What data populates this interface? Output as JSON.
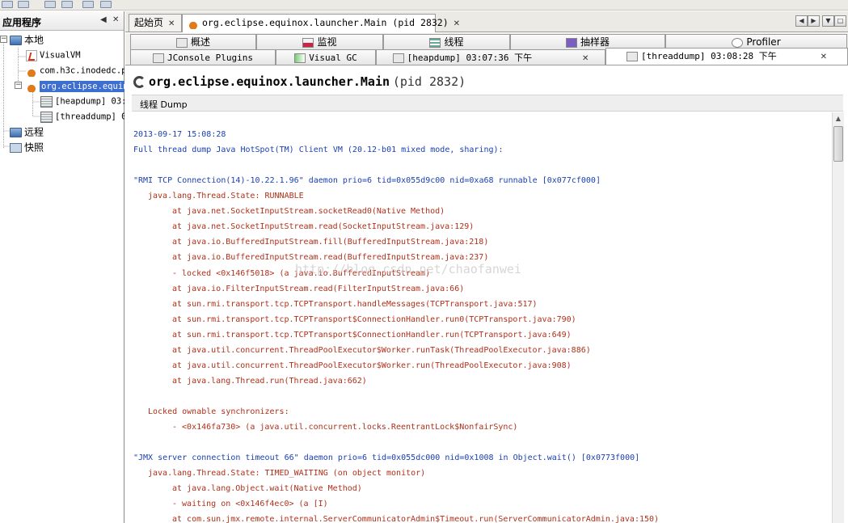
{
  "left_panel": {
    "title": "应用程序",
    "pin_label": "◀",
    "close_label": "✕",
    "nodes": {
      "local": "本地",
      "visualvm": "VisualVM",
      "h3c": "com.h3c.inodedc.p",
      "eclipse": "org.eclipse.equin",
      "heapdump": "[heapdump] 03:",
      "threaddump": "[threaddump] 0",
      "remote": "远程",
      "snapshot": "快照"
    }
  },
  "doc_tabs": {
    "start": "起始页",
    "start_close": "✕",
    "process": "org.eclipse.equinox.launcher.Main (pid 2832)",
    "process_close": "✕"
  },
  "sub_tabs_row1": [
    "概述",
    "监视",
    "线程",
    "抽样器",
    "Profiler"
  ],
  "sub_tabs_row2": {
    "jconsole": "JConsole Plugins",
    "visualgc": "Visual GC",
    "heapdump": "[heapdump] 03:07:36 下午",
    "heapdump_close": "✕",
    "threaddump": "[threaddump] 03:08:28 下午",
    "threaddump_close": "✕"
  },
  "content": {
    "main_class": "org.eclipse.equinox.launcher.Main",
    "pid": "(pid 2832)",
    "section": "线程 Dump"
  },
  "watermark": "http://blog.csdn.net/chaofanwei",
  "dump_lines": [
    {
      "text": "2013-09-17 15:08:28",
      "color": "blue",
      "indent": 0
    },
    {
      "text": "Full thread dump Java HotSpot(TM) Client VM (20.12-b01 mixed mode, sharing):",
      "color": "blue",
      "indent": 0
    },
    {
      "text": "",
      "color": "blue",
      "indent": 0
    },
    {
      "text": "\"RMI TCP Connection(14)-10.22.1.96\" daemon prio=6 tid=0x055d9c00 nid=0xa68 runnable [0x077cf000]",
      "color": "blue",
      "indent": 0
    },
    {
      "text": "java.lang.Thread.State: RUNNABLE",
      "color": "red",
      "indent": 1
    },
    {
      "text": "at java.net.SocketInputStream.socketRead0(Native Method)",
      "color": "red",
      "indent": 2
    },
    {
      "text": "at java.net.SocketInputStream.read(SocketInputStream.java:129)",
      "color": "red",
      "indent": 2
    },
    {
      "text": "at java.io.BufferedInputStream.fill(BufferedInputStream.java:218)",
      "color": "red",
      "indent": 2
    },
    {
      "text": "at java.io.BufferedInputStream.read(BufferedInputStream.java:237)",
      "color": "red",
      "indent": 2
    },
    {
      "text": "- locked <0x146f5018> (a java.io.BufferedInputStream)",
      "color": "red",
      "indent": 2
    },
    {
      "text": "at java.io.FilterInputStream.read(FilterInputStream.java:66)",
      "color": "red",
      "indent": 2
    },
    {
      "text": "at sun.rmi.transport.tcp.TCPTransport.handleMessages(TCPTransport.java:517)",
      "color": "red",
      "indent": 2
    },
    {
      "text": "at sun.rmi.transport.tcp.TCPTransport$ConnectionHandler.run0(TCPTransport.java:790)",
      "color": "red",
      "indent": 2
    },
    {
      "text": "at sun.rmi.transport.tcp.TCPTransport$ConnectionHandler.run(TCPTransport.java:649)",
      "color": "red",
      "indent": 2
    },
    {
      "text": "at java.util.concurrent.ThreadPoolExecutor$Worker.runTask(ThreadPoolExecutor.java:886)",
      "color": "red",
      "indent": 2
    },
    {
      "text": "at java.util.concurrent.ThreadPoolExecutor$Worker.run(ThreadPoolExecutor.java:908)",
      "color": "red",
      "indent": 2
    },
    {
      "text": "at java.lang.Thread.run(Thread.java:662)",
      "color": "red",
      "indent": 2
    },
    {
      "text": "",
      "color": "red",
      "indent": 0
    },
    {
      "text": "Locked ownable synchronizers:",
      "color": "red",
      "indent": 1
    },
    {
      "text": "- <0x146fa730> (a java.util.concurrent.locks.ReentrantLock$NonfairSync)",
      "color": "red",
      "indent": 2
    },
    {
      "text": "",
      "color": "red",
      "indent": 0
    },
    {
      "text": "\"JMX server connection timeout 66\" daemon prio=6 tid=0x055dc000 nid=0x1008 in Object.wait() [0x0773f000]",
      "color": "blue",
      "indent": 0
    },
    {
      "text": "java.lang.Thread.State: TIMED_WAITING (on object monitor)",
      "color": "red",
      "indent": 1
    },
    {
      "text": "at java.lang.Object.wait(Native Method)",
      "color": "red",
      "indent": 2
    },
    {
      "text": "- waiting on <0x146f4ec0> (a [I)",
      "color": "red",
      "indent": 2
    },
    {
      "text": "at com.sun.jmx.remote.internal.ServerCommunicatorAdmin$Timeout.run(ServerCommunicatorAdmin.java:150)",
      "color": "red",
      "indent": 2
    }
  ],
  "colors": {
    "blue_text": "#1a3fb0",
    "red_text": "#b0301a",
    "selection": "#3d6fd1"
  }
}
